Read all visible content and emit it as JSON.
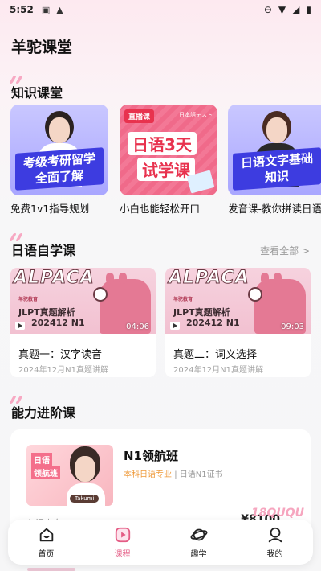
{
  "status_bar": {
    "time": "5:52",
    "icons_left": [
      "photo-icon",
      "warning-icon"
    ],
    "icons_right": [
      "do-not-disturb-icon",
      "wifi-icon",
      "signal-icon",
      "battery-icon"
    ]
  },
  "app": {
    "title": "羊驼课堂"
  },
  "knowledge": {
    "title": "知识课堂",
    "items": [
      {
        "ribbon_line1": "考级考研留学",
        "ribbon_line2": "全面了解",
        "label": "免费1v1指导规划"
      },
      {
        "tag": "直播课",
        "small_jp": "日本語テスト",
        "big_line1": "日语3天",
        "big_line2": "试学课",
        "label": "小白也能轻松开口"
      },
      {
        "ribbon_line1": "日语文字基础",
        "ribbon_line2": "知识",
        "label": "发音课-教你拼读日语"
      }
    ]
  },
  "self_study": {
    "title": "日语自学课",
    "view_all": "查看全部 >",
    "items": [
      {
        "brand": "ALPACA",
        "logo": "羊驼教育",
        "thumb_line1": "JLPT真题解析",
        "thumb_line2": "202412 N1",
        "duration": "04:06",
        "title": "真题一：汉字读音",
        "subtitle": "2024年12月N1真题讲解"
      },
      {
        "brand": "ALPACA",
        "logo": "羊驼教育",
        "thumb_line1": "JLPT真题解析",
        "thumb_line2": "202412 N1",
        "duration": "09:03",
        "title": "真题二：词义选择",
        "subtitle": "2024年12月N1真题讲解"
      }
    ]
  },
  "advanced": {
    "title": "能力进阶课",
    "course": {
      "thumb_line1": "日语",
      "thumb_line2": "领航班",
      "teacher": "Takumi",
      "name": "N1领航班",
      "major": "本科日语专业",
      "cert": "日语N1证书",
      "footer_left": "入门小白",
      "price": "¥8100",
      "watermark": "18QUQU"
    }
  },
  "bottom_nav": {
    "items": [
      {
        "label": "首页",
        "icon": "home-icon"
      },
      {
        "label": "课程",
        "icon": "play-icon",
        "active": true
      },
      {
        "label": "趣学",
        "icon": "planet-icon"
      },
      {
        "label": "我的",
        "icon": "profile-icon"
      }
    ],
    "active_color": "#e45b84"
  },
  "colors": {
    "accent": "#e45b84",
    "knowledge_ribbon": "#3d3ce0",
    "section_accent": "#f7a9c3"
  }
}
